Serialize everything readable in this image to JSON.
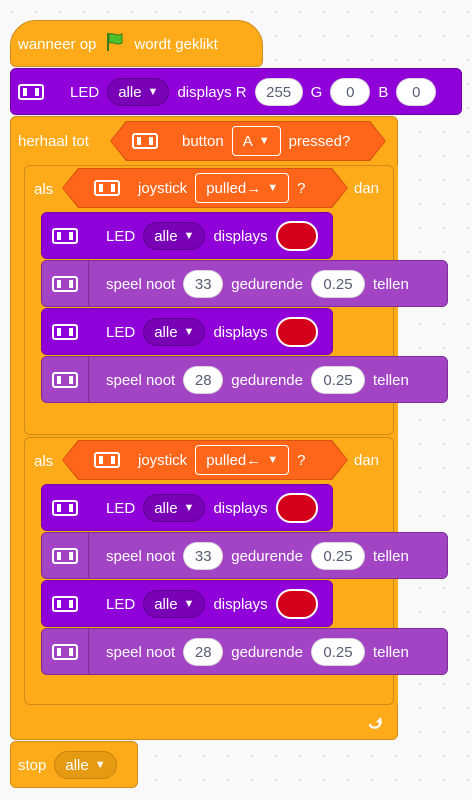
{
  "event": {
    "prefix": "wanneer op",
    "suffix": "wordt geklikt",
    "flag_icon": "green-flag-icon"
  },
  "led_all": {
    "label": "LED",
    "target": "alle",
    "text": "displays R",
    "r_label": "R",
    "r": "255",
    "g_label": "G",
    "g": "0",
    "b_label": "B",
    "b": "0"
  },
  "repeat": {
    "label": "herhaal tot",
    "button_label": "button",
    "button_value": "A",
    "pressed": "pressed?"
  },
  "if1": {
    "label": "als",
    "joystick": "joystick",
    "dir": "pulled→",
    "q": "?",
    "then": "dan",
    "led1": {
      "label": "LED",
      "target": "alle",
      "text": "displays",
      "color": "#d4001a"
    },
    "note1": {
      "label": "speel noot",
      "note": "33",
      "for": "gedurende",
      "beats": "0.25",
      "unit": "tellen"
    },
    "led2": {
      "label": "LED",
      "target": "alle",
      "text": "displays",
      "color": "#d4001a"
    },
    "note2": {
      "label": "speel noot",
      "note": "28",
      "for": "gedurende",
      "beats": "0.25",
      "unit": "tellen"
    }
  },
  "if2": {
    "label": "als",
    "joystick": "joystick",
    "dir": "pulled←",
    "q": "?",
    "then": "dan",
    "led1": {
      "label": "LED",
      "target": "alle",
      "text": "displays",
      "color": "#d4001a"
    },
    "note1": {
      "label": "speel noot",
      "note": "33",
      "for": "gedurende",
      "beats": "0.25",
      "unit": "tellen"
    },
    "led2": {
      "label": "LED",
      "target": "alle",
      "text": "displays",
      "color": "#d4001a"
    },
    "note2": {
      "label": "speel noot",
      "note": "28",
      "for": "gedurende",
      "beats": "0.25",
      "unit": "tellen"
    }
  },
  "stop": {
    "label": "stop",
    "value": "alle"
  },
  "colors": {
    "control": "#ffab19",
    "led": "#9000d8",
    "sound": "#a244c4",
    "sensing": "#ff661a",
    "swatch": "#d4001a"
  }
}
